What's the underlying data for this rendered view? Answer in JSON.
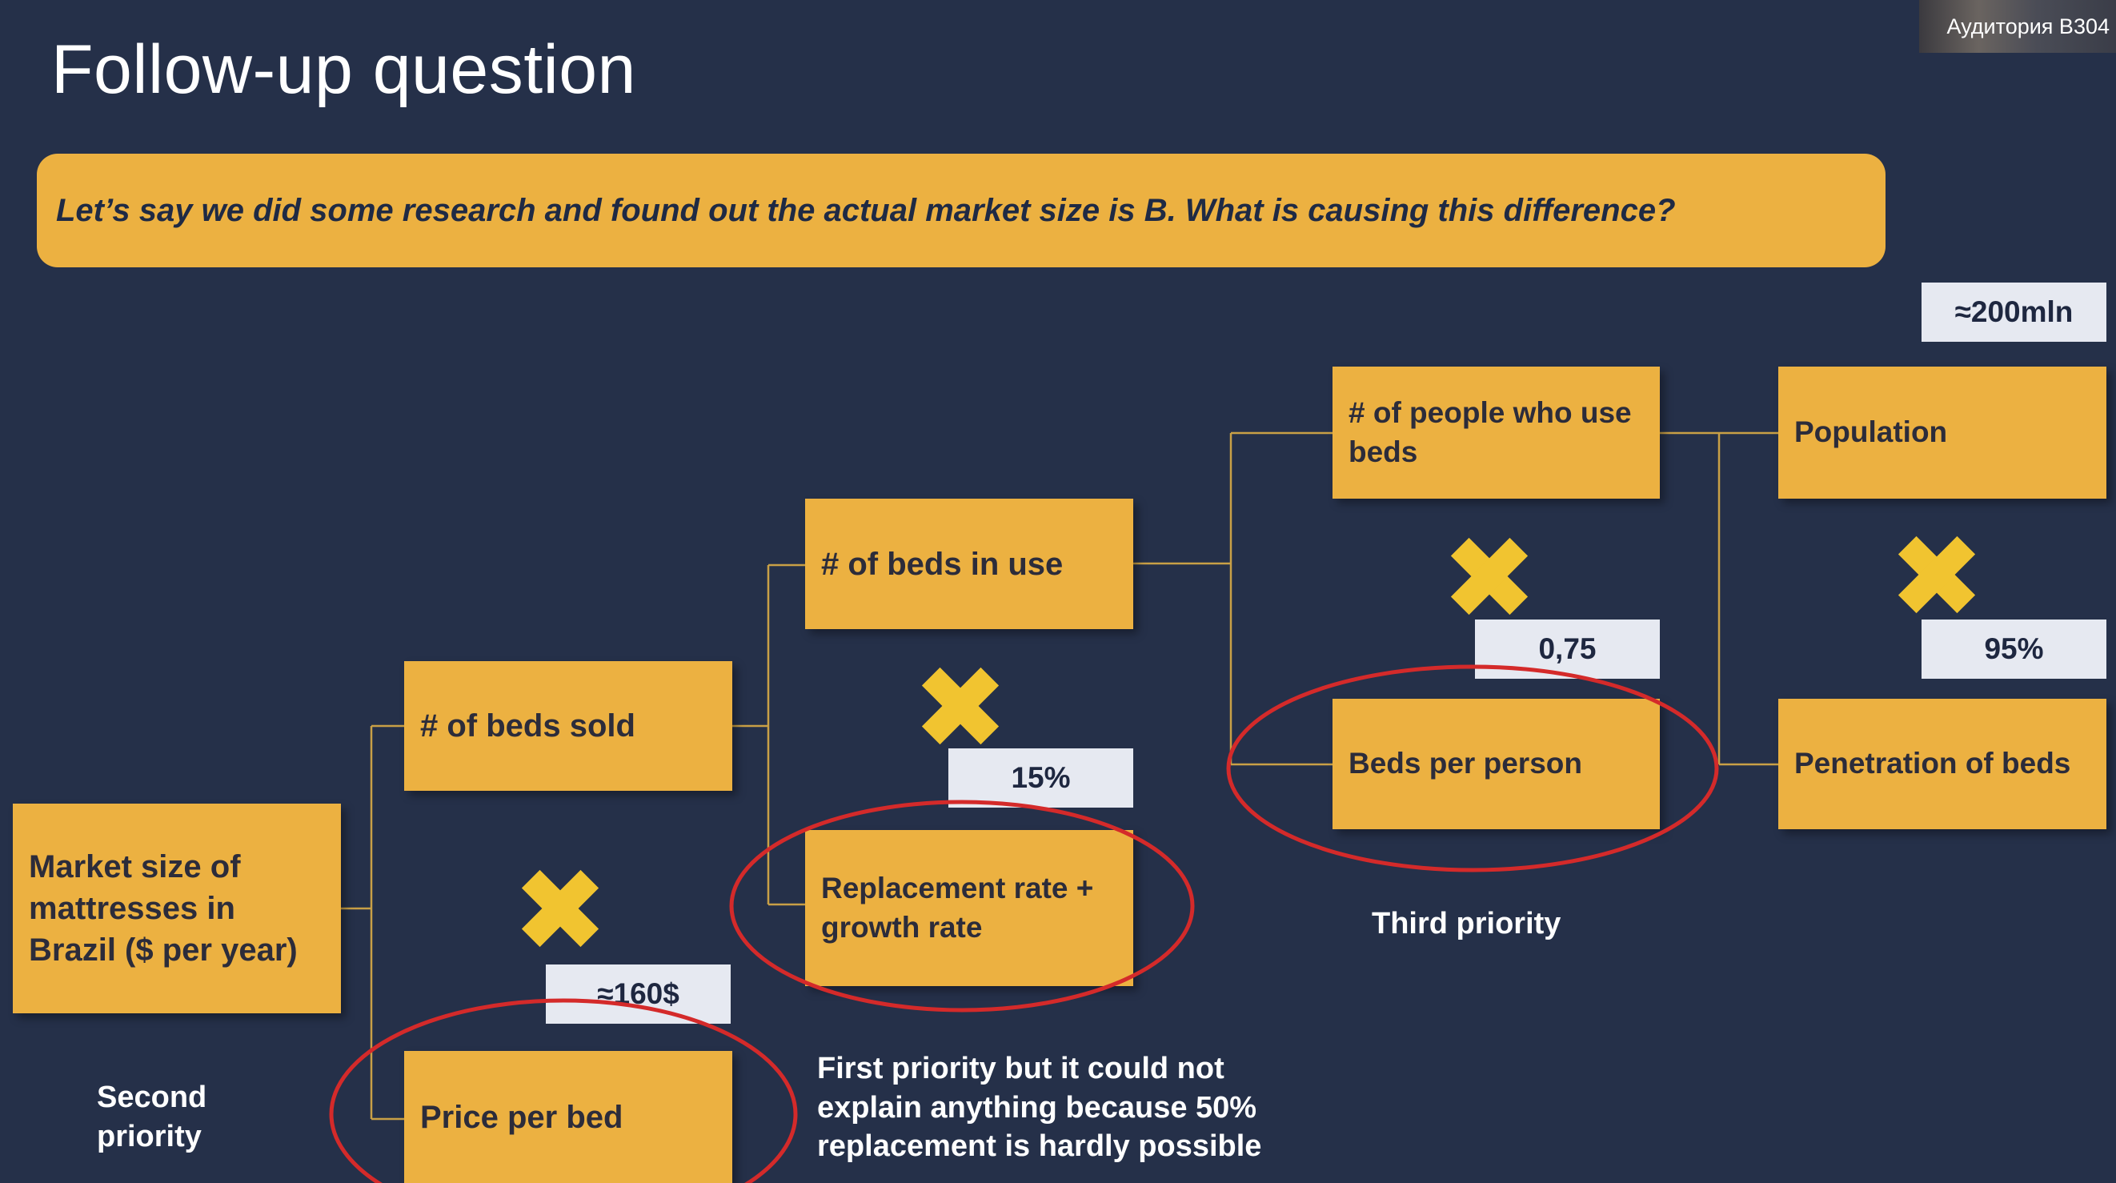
{
  "slide": {
    "title": "Follow-up question",
    "question": "Let’s say we did some research and found out the actual market size is B. What is causing this difference?"
  },
  "webcam_label": "Аудитория B304",
  "nodes": {
    "market_size": "Market size of mattresses in Brazil ($ per year)",
    "beds_sold": "# of beds sold",
    "price_per_bed": "Price per bed",
    "beds_in_use": "# of beds in use",
    "replacement_rate": "Replacement rate + growth rate",
    "people_use_beds": "# of people who use beds",
    "beds_per_person": "Beds per person",
    "population": "Population",
    "penetration": "Penetration of beds"
  },
  "values": {
    "price": "≈160$",
    "replacement": "15%",
    "beds_per_person": "0,75",
    "population": "≈200mln",
    "penetration": "95%"
  },
  "annotations": {
    "second_priority": "Second priority",
    "first_priority": "First priority but it could not explain anything because 50% replacement is hardly possible",
    "third_priority": "Third priority"
  },
  "colors": {
    "background": "#253049",
    "node": "#ecb141",
    "value_box": "#e6e9f1",
    "circle": "#d42a2a",
    "cross": "#f1c430",
    "connector": "#c9a046"
  },
  "icons": [
    "multiply-cross-icon"
  ]
}
